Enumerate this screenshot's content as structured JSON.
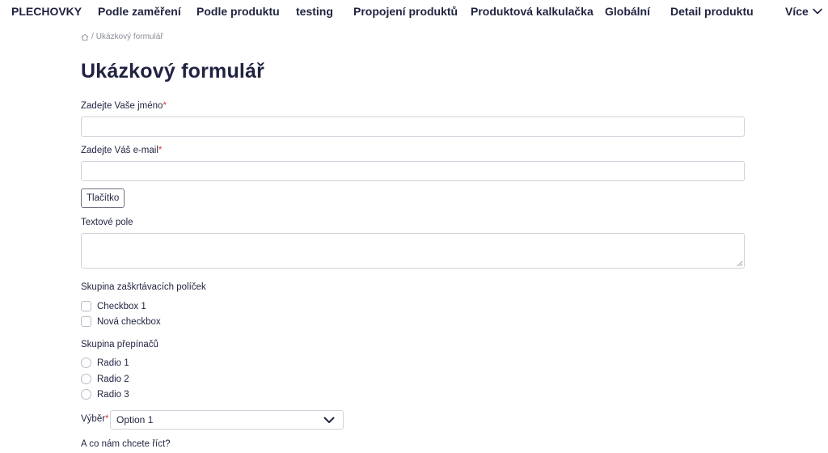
{
  "nav": {
    "brand": "PLECHOVKY",
    "items": [
      "Podle zaměření",
      "Podle produktu",
      "testing",
      "Propojení produktů",
      "Produktová kalkulačka",
      "Globální",
      "Detail produktu"
    ],
    "more_label": "Více",
    "more_icon": "chevron-down-icon"
  },
  "breadcrumb": {
    "home_icon": "home-icon",
    "separator": "/",
    "current": "Ukázkový formulář"
  },
  "page": {
    "title": "Ukázkový formulář"
  },
  "form": {
    "name": {
      "label": "Zadejte Vaše jméno",
      "required_mark": "*",
      "value": "",
      "placeholder": ""
    },
    "email": {
      "label": "Zadejte Váš e-mail",
      "required_mark": "*",
      "value": "",
      "placeholder": ""
    },
    "button_label": "Tlačítko",
    "textarea": {
      "label": "Textové pole",
      "value": ""
    },
    "checkbox_group": {
      "label": "Skupina zaškrtávacích políček",
      "options": [
        {
          "label": "Checkbox 1",
          "checked": false
        },
        {
          "label": "Nová checkbox",
          "checked": false
        }
      ]
    },
    "radio_group": {
      "label": "Skupina přepínačů",
      "options": [
        {
          "label": "Radio 1",
          "selected": false
        },
        {
          "label": "Radio 2",
          "selected": false
        },
        {
          "label": "Radio 3",
          "selected": false
        }
      ]
    },
    "select": {
      "label": "Výběr",
      "required_mark": "*",
      "selected": "Option 1"
    },
    "question_label": "A co nám chcete říct?"
  },
  "colors": {
    "text": "#1f2340",
    "required": "#d93a3a",
    "border": "#cfd2da",
    "muted": "#8a8d9a"
  }
}
